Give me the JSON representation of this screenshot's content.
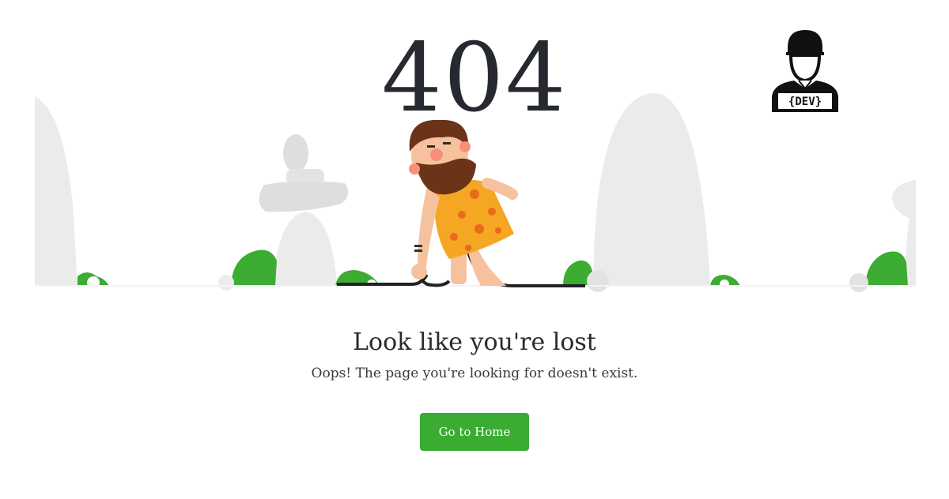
{
  "error": {
    "code": "404",
    "heading": "Look like you're lost",
    "message": "Oops! The page you're looking for doesn't exist.",
    "home_button_label": "Go to Home"
  },
  "logo": {
    "text": "{DEV}"
  },
  "colors": {
    "button": "#39ac31",
    "code": "#262a30",
    "rock": "#e9e9e9",
    "bush": "#3cac32",
    "skin": "#f6c29d",
    "tunic": "#f5a623",
    "beard": "#6b3317"
  }
}
